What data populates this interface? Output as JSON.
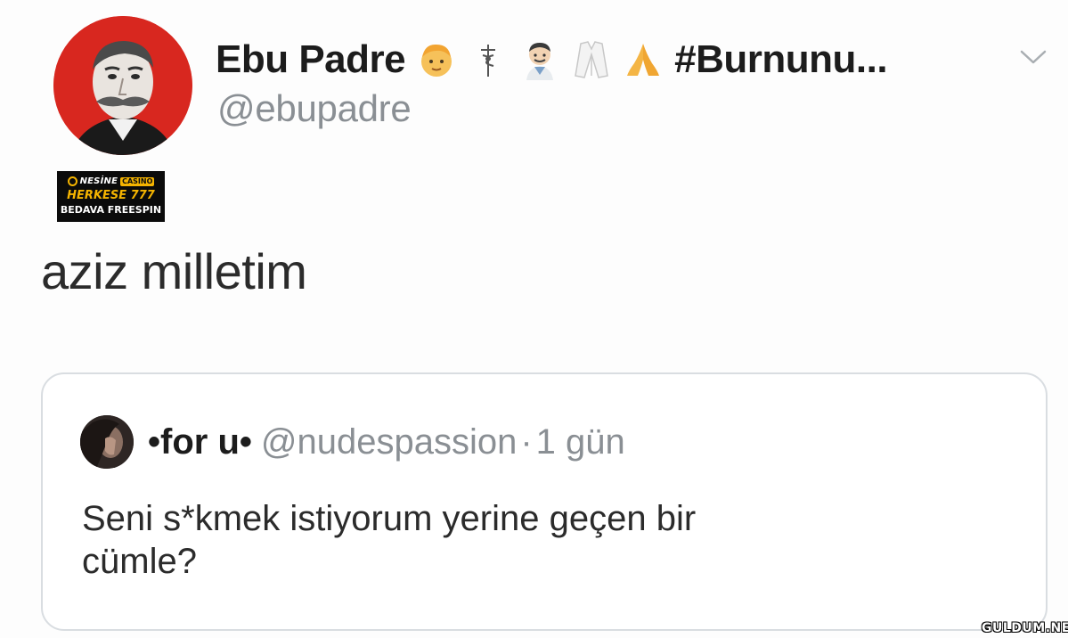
{
  "tweet": {
    "display_name": "Ebu Padre",
    "hashtag_truncated": "#Burnunu...",
    "handle": "@ebupadre",
    "text": "aziz milletim",
    "name_emojis": [
      "person-icon",
      "caduceus-icon",
      "doctor-icon",
      "lab-coat-icon",
      "folded-hands-icon"
    ]
  },
  "ad": {
    "brand": "NESİNE",
    "brand_tag": "CASINO",
    "line1": "HERKESE 777",
    "line2": "BEDAVA FREESPIN"
  },
  "quote": {
    "name": "•for u•",
    "handle": "@nudespassion",
    "separator": "·",
    "time": "1 gün",
    "text_line1": "Seni s*kmek istiyorum yerine geçen bir",
    "text_line2": "cümle?"
  },
  "watermark": "GULDUM.NET",
  "colors": {
    "avatar_ring": "#d8271f",
    "muted_text": "#8a8f94",
    "primary_text": "#1c1c1c",
    "card_border": "#d9dde1",
    "ad_accent": "#f5b400"
  }
}
